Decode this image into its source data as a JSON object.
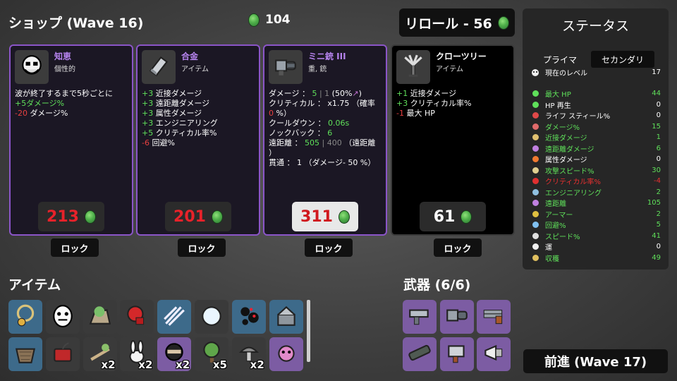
{
  "header": {
    "shop_title": "ショップ (Wave 16)",
    "materials": "104",
    "reroll_label": "リロール - 56"
  },
  "cards": [
    {
      "name": "知恵",
      "subtitle": "個性的",
      "icon": "wisdom-face-icon",
      "lines": [
        {
          "parts": [
            {
              "t": "波が終了するまで5秒ごとに",
              "c": ""
            }
          ]
        },
        {
          "parts": [
            {
              "t": "+5ダメージ%",
              "c": "g"
            }
          ]
        },
        {
          "parts": [
            {
              "t": "-20",
              "c": "r"
            },
            {
              "t": " ダメージ%",
              "c": ""
            }
          ]
        }
      ],
      "price": "213",
      "lock": "ロック"
    },
    {
      "name": "合金",
      "subtitle": "アイテム",
      "icon": "alloy-ingot-icon",
      "lines": [
        {
          "parts": [
            {
              "t": "+3",
              "c": "g"
            },
            {
              "t": " 近接ダメージ",
              "c": ""
            }
          ]
        },
        {
          "parts": [
            {
              "t": "+3",
              "c": "g"
            },
            {
              "t": " 遠距離ダメージ",
              "c": ""
            }
          ]
        },
        {
          "parts": [
            {
              "t": "+3",
              "c": "g"
            },
            {
              "t": " 属性ダメージ",
              "c": ""
            }
          ]
        },
        {
          "parts": [
            {
              "t": "+3",
              "c": "g"
            },
            {
              "t": " エンジニアリング",
              "c": ""
            }
          ]
        },
        {
          "parts": [
            {
              "t": "+5",
              "c": "g"
            },
            {
              "t": " クリティカル率%",
              "c": ""
            }
          ]
        },
        {
          "parts": [
            {
              "t": "-6",
              "c": "r"
            },
            {
              "t": " 回避%",
              "c": ""
            }
          ]
        }
      ],
      "price": "201",
      "lock": "ロック"
    },
    {
      "name": "ミニ銃 III",
      "subtitle": "重, 銃",
      "icon": "minigun-icon",
      "lines": [
        {
          "parts": [
            {
              "t": "ダメージ ： ",
              "c": ""
            },
            {
              "t": "5",
              "c": "g"
            },
            {
              "t": " | 1 ",
              "c": "gr"
            },
            {
              "t": "(50%",
              "c": ""
            },
            {
              "t": "↗",
              "c": "p"
            },
            {
              "t": ")",
              "c": ""
            }
          ]
        },
        {
          "parts": [
            {
              "t": "クリティカル ： x1.75 （確率 ",
              "c": ""
            }
          ]
        },
        {
          "parts": [
            {
              "t": "0",
              "c": "r"
            },
            {
              "t": " %）",
              "c": ""
            }
          ]
        },
        {
          "parts": [
            {
              "t": "クールダウン ： ",
              "c": ""
            },
            {
              "t": "0.06s",
              "c": "g"
            }
          ]
        },
        {
          "parts": [
            {
              "t": "ノックバック ： ",
              "c": ""
            },
            {
              "t": "6",
              "c": "g"
            }
          ]
        },
        {
          "parts": [
            {
              "t": "遠距離 ： ",
              "c": ""
            },
            {
              "t": "505",
              "c": "g"
            },
            {
              "t": " | 400 ",
              "c": "gr"
            },
            {
              "t": "（遠距離",
              "c": ""
            }
          ]
        },
        {
          "parts": [
            {
              "t": "）",
              "c": ""
            }
          ]
        },
        {
          "parts": [
            {
              "t": "貫通 ： 1 （ダメージ- 50 %）",
              "c": ""
            }
          ]
        }
      ],
      "price": "311",
      "lock": "ロック"
    },
    {
      "name": "クローツリー",
      "subtitle": "アイテム",
      "icon": "claw-tree-icon",
      "lines": [
        {
          "parts": [
            {
              "t": "+1",
              "c": "g"
            },
            {
              "t": " 近接ダメージ",
              "c": ""
            }
          ]
        },
        {
          "parts": [
            {
              "t": "+3",
              "c": "g"
            },
            {
              "t": " クリティカル率%",
              "c": ""
            }
          ]
        },
        {
          "parts": [
            {
              "t": "-1",
              "c": "r"
            },
            {
              "t": " 最大 HP",
              "c": ""
            }
          ]
        }
      ],
      "price": "61",
      "lock": "ロック"
    }
  ],
  "stats": {
    "title": "ステータス",
    "tab_primary": "プライマ",
    "tab_secondary": "セカンダリ",
    "level": {
      "label": "現在のレベル",
      "value": "17",
      "icon": "level-icon"
    },
    "rows": [
      {
        "label": "最大 HP",
        "value": "44",
        "color": "g",
        "icon": "heart-icon"
      },
      {
        "label": "HP 再生",
        "value": "0",
        "color": "",
        "icon": "regen-icon"
      },
      {
        "label": "ライフ スティール%",
        "value": "0",
        "color": "",
        "icon": "lifesteal-icon"
      },
      {
        "label": "ダメージ%",
        "value": "15",
        "color": "g",
        "icon": "damage-icon"
      },
      {
        "label": "近接ダメージ",
        "value": "1",
        "color": "g",
        "icon": "melee-icon"
      },
      {
        "label": "遠距離ダメージ",
        "value": "6",
        "color": "g",
        "icon": "ranged-icon"
      },
      {
        "label": "属性ダメージ",
        "value": "0",
        "color": "",
        "icon": "elemental-icon"
      },
      {
        "label": "攻撃スピード%",
        "value": "30",
        "color": "g",
        "icon": "attack-speed-icon"
      },
      {
        "label": "クリティカル率%",
        "value": "-4",
        "color": "r",
        "icon": "crit-icon"
      },
      {
        "label": "エンジニアリング",
        "value": "2",
        "color": "g",
        "icon": "engineering-icon"
      },
      {
        "label": "遠距離",
        "value": "105",
        "color": "g",
        "icon": "range-icon"
      },
      {
        "label": "アーマー",
        "value": "2",
        "color": "g",
        "icon": "armor-icon"
      },
      {
        "label": "回避%",
        "value": "5",
        "color": "g",
        "icon": "dodge-icon"
      },
      {
        "label": "スピード%",
        "value": "41",
        "color": "g",
        "icon": "speed-icon"
      },
      {
        "label": "運",
        "value": "0",
        "color": "",
        "icon": "luck-icon"
      },
      {
        "label": "収穫",
        "value": "49",
        "color": "g",
        "icon": "harvest-icon"
      }
    ]
  },
  "items_section": {
    "title": "アイテム",
    "items": [
      {
        "icon": "pendant-icon",
        "count": "",
        "bg": "blue"
      },
      {
        "icon": "egg-face-icon",
        "count": "",
        "bg": "gray"
      },
      {
        "icon": "moss-rock-icon",
        "count": "",
        "bg": "gray"
      },
      {
        "icon": "boxing-glove-icon",
        "count": "",
        "bg": "gray"
      },
      {
        "icon": "claw-scratch-icon",
        "count": "",
        "bg": "blue"
      },
      {
        "icon": "snowball-icon",
        "count": "",
        "bg": "gray"
      },
      {
        "icon": "black-blobs-icon",
        "count": "",
        "bg": "blue"
      },
      {
        "icon": "ruined-house-icon",
        "count": "",
        "bg": "blue"
      },
      {
        "icon": "basket-icon",
        "count": "",
        "bg": "blue"
      },
      {
        "icon": "dynamite-icon",
        "count": "",
        "bg": "gray"
      },
      {
        "icon": "crossbow-plant-icon",
        "count": "x2",
        "bg": "gray"
      },
      {
        "icon": "bunny-icon",
        "count": "x2",
        "bg": "gray"
      },
      {
        "icon": "ninja-icon",
        "count": "x2",
        "bg": "purp"
      },
      {
        "icon": "tree-icon",
        "count": "x5",
        "bg": "gray"
      },
      {
        "icon": "mushroom-icon",
        "count": "x2",
        "bg": "gray"
      },
      {
        "icon": "pink-virus-icon",
        "count": "",
        "bg": "purp"
      }
    ]
  },
  "weapons_section": {
    "title": "武器 (6/6)",
    "weapons": [
      {
        "icon": "smg-icon"
      },
      {
        "icon": "minigun-weapon-icon"
      },
      {
        "icon": "double-barrel-icon"
      },
      {
        "icon": "rocket-launcher-icon"
      },
      {
        "icon": "lightning-gun-icon"
      },
      {
        "icon": "megaphone-icon"
      }
    ]
  },
  "go_button": "前進 (Wave 17)",
  "colors": {
    "green": "#5fe05a",
    "red": "#e84040",
    "purple_border": "#8b55c8",
    "item_blue": "#3d6a8a",
    "item_purple": "#7c5ca3"
  }
}
